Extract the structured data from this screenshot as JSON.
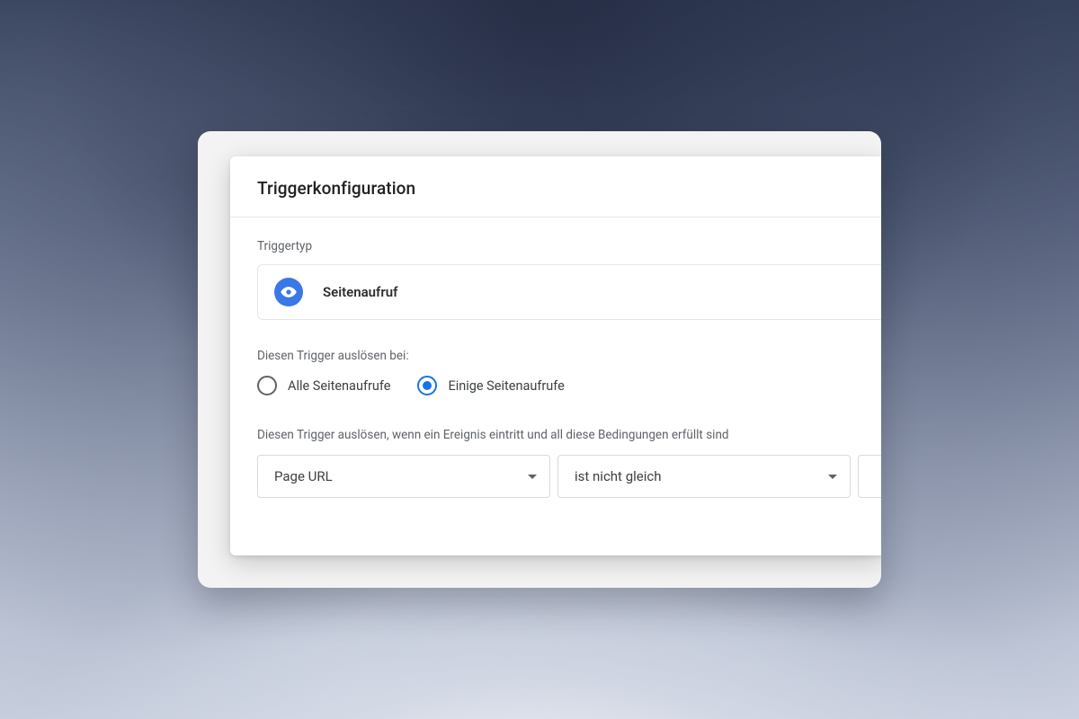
{
  "header": {
    "title": "Triggerkonfiguration"
  },
  "trigger_type": {
    "label": "Triggertyp",
    "icon": "eye-icon",
    "name": "Seitenaufruf"
  },
  "fire_on": {
    "label": "Diesen Trigger auslösen bei:",
    "options": [
      {
        "id": "all",
        "label": "Alle Seitenaufrufe",
        "checked": false
      },
      {
        "id": "some",
        "label": "Einige Seitenaufrufe",
        "checked": true
      }
    ]
  },
  "condition": {
    "label": "Diesen Trigger auslösen, wenn ein Ereignis eintritt und all diese Bedingungen erfüllt sind",
    "variable": "Page URL",
    "operator": "ist nicht gleich",
    "value": ""
  },
  "colors": {
    "accent": "#1a73e8",
    "icon_bg": "#3b78e7"
  }
}
